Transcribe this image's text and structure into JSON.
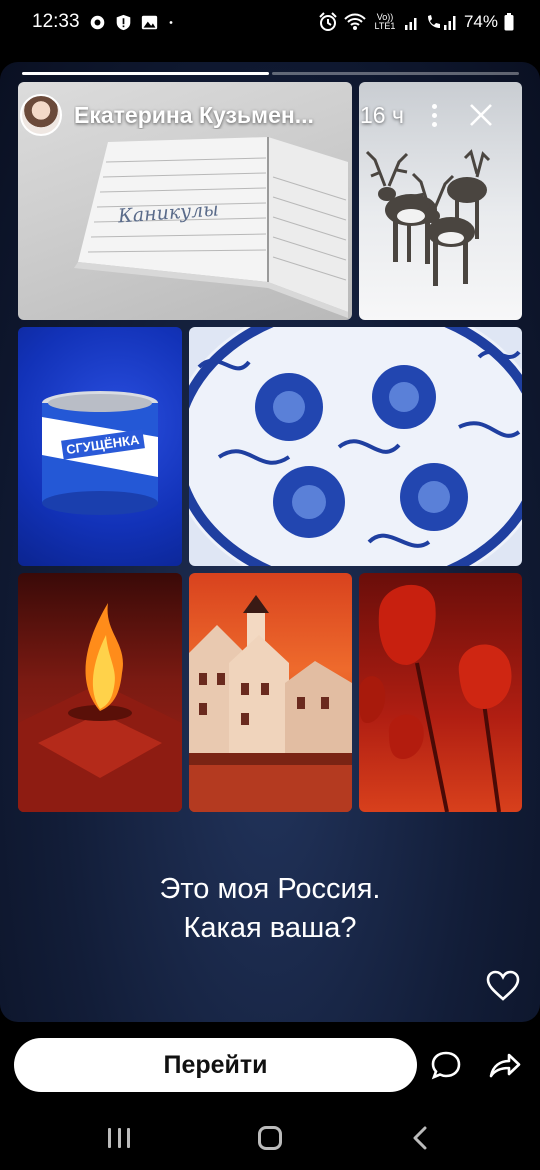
{
  "status_bar": {
    "time": "12:33",
    "network": "Vo)) LTE1",
    "battery": "74%"
  },
  "story": {
    "author": "Екатерина Кузьмен...",
    "time": "16 ч",
    "progress": {
      "segments": 2,
      "completed": 1
    },
    "caption_line1": "Это моя Россия.",
    "caption_line2": "Какая ваша?"
  },
  "collage": {
    "notebook_text": "Каникулы",
    "milk_can_label": "СГУЩЁНКА",
    "tiles": [
      "notebook-photo",
      "reindeer-photo",
      "condensed-milk-photo",
      "gzhel-plate-photo",
      "eternal-flame-photo",
      "lighthouse-town-photo",
      "red-tulips-photo"
    ]
  },
  "actions": {
    "goto_label": "Перейти"
  },
  "icons": {
    "status": [
      "messenger-icon",
      "shield-icon",
      "gallery-icon",
      "alarm-icon",
      "wifi-icon",
      "signal-icon",
      "battery-icon"
    ],
    "story": [
      "more-icon",
      "close-icon",
      "heart-icon",
      "message-icon",
      "share-icon"
    ],
    "nav": [
      "recent-apps-icon",
      "home-icon",
      "back-icon"
    ]
  },
  "colors": {
    "background": "#000000",
    "card_gradient_center": "#22345c",
    "card_gradient_edge": "#0a1022",
    "button_bg": "#ffffff",
    "button_text": "#111111"
  }
}
